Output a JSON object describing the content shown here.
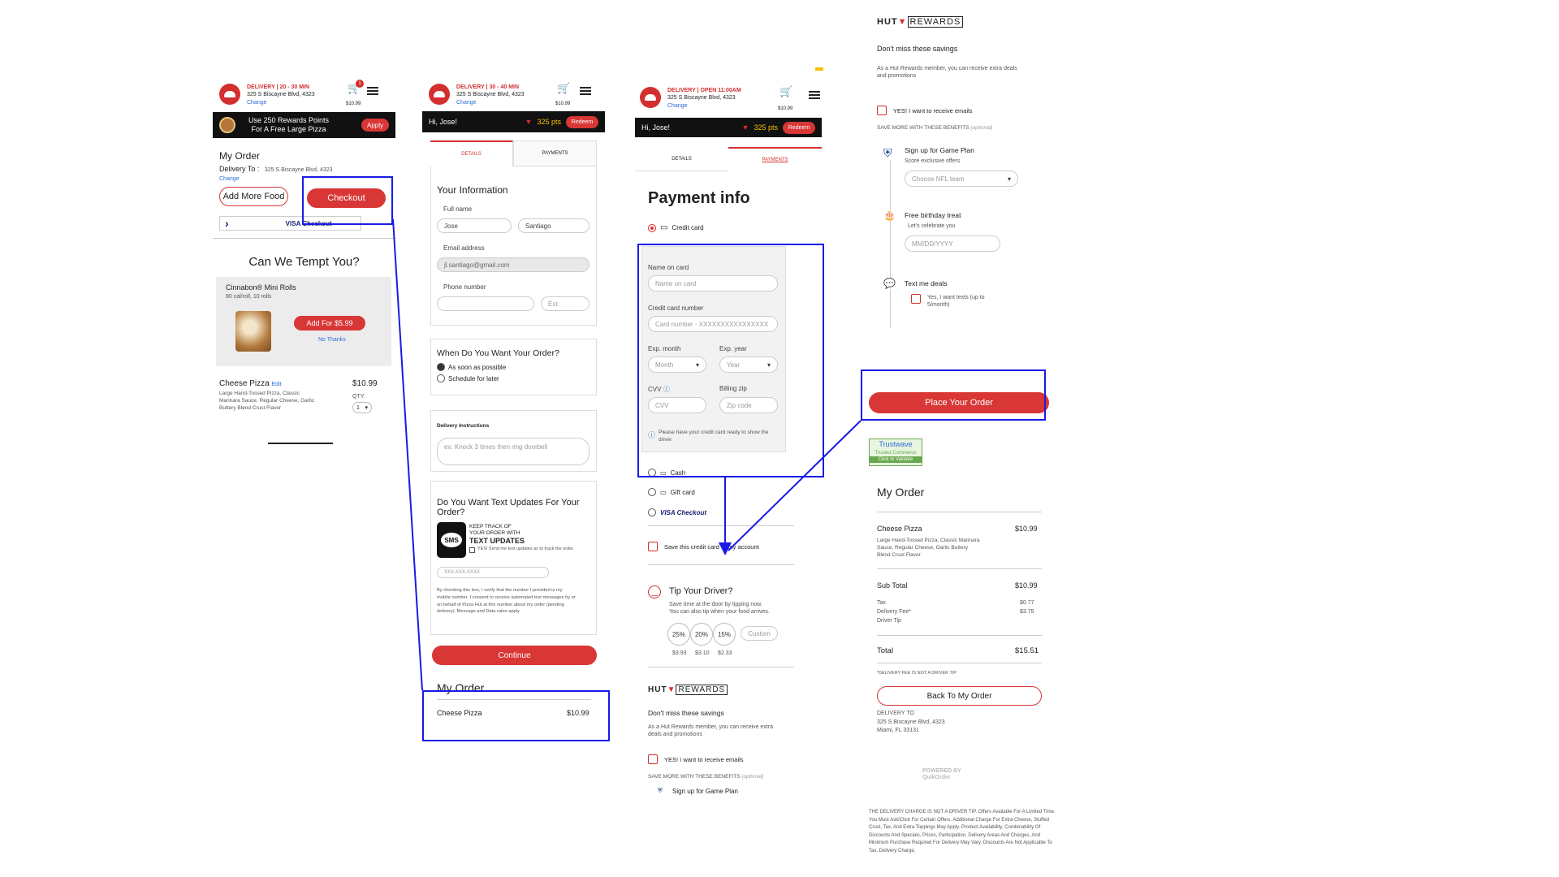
{
  "colors": {
    "brand": "#d93636",
    "highlight": "#1a1ae6",
    "dark": "#111111"
  },
  "s1": {
    "header": {
      "delivery": "DELIVERY | 20 - 30 MIN",
      "address": "325 S Biscayne Blvd, 4323",
      "change": "Change",
      "cart_total": "$10.99",
      "cart_count": "1"
    },
    "promo": {
      "text1": "Use 250 Rewards Points",
      "text2": "For A Free Large Pizza",
      "apply": "Apply"
    },
    "my_order": "My Order",
    "delivery_to_label": "Delivery To :",
    "delivery_to": "325 S Biscayne Blvd, 4323",
    "change": "Change",
    "add_more": "Add More Food",
    "checkout": "Checkout",
    "visa": "VISA Checkout",
    "tempt": "Can We Tempt You?",
    "upsell_name": "Cinnabon® Mini Rolls",
    "upsell_sub": "80 cal/roll, 10 rolls",
    "add_btn": "Add For $5.99",
    "no_thanks": "No Thanks",
    "item_name": "Cheese Pizza",
    "item_edit": "Edit",
    "item_price": "$10.99",
    "item_desc": "Large Hand-Tossed Pizza, Classic Marinara Sauce, Regular Cheese, Garlic Buttery Blend Crust Flavor",
    "qty_label": "QTY:",
    "qty": "1"
  },
  "s2": {
    "header": {
      "delivery": "DELIVERY | 30 - 40 MIN",
      "address": "325 S Biscayne Blvd, 4323",
      "change": "Change",
      "cart_total": "$10.99"
    },
    "bar": {
      "hi": "Hi, Jose!",
      "pts": "325 pts",
      "redeem": "Redeem"
    },
    "tabs": [
      "DETAILS",
      "PAYMENTS"
    ],
    "your_info": "Your Information",
    "full_name": "Full name",
    "first": "Jose",
    "last": "Santiago",
    "email_label": "Email address",
    "email": "jl.santiago@gmail.com",
    "phone_label": "Phone number",
    "ext": "Ext.",
    "when": "When Do You Want Your Order?",
    "asap": "As soon as possible",
    "schedule": "Schedule for later",
    "instructions_label": "Delivery Instructions",
    "instructions_ph": "ex: Knock 3 times then ring doorbell",
    "text_updates": "Do You Want Text Updates For Your Order?",
    "keep1": "KEEP TRACK OF",
    "keep2": "YOUR ORDER WITH",
    "keep3": "TEXT UPDATES",
    "sms": "SMS",
    "yes_send": "YES! Send me text updates as to track the order.",
    "phone_ph": "XXX-XXX-XXXX",
    "legal": "By checking this box, I verify that the number I provided is my mobile number. I consent to receive automated text messages by or on behalf of Pizza Hut at this number about my order (pending delivery). Message and Data rates apply.",
    "continue": "Continue",
    "my_order": "My Order",
    "item": "Cheese Pizza",
    "price": "$10.99"
  },
  "s3": {
    "header": {
      "delivery": "DELIVERY | OPEN 11:00AM",
      "address": "325 S Biscayne Blvd, 4323",
      "change": "Change",
      "cart_total": "$10.99"
    },
    "bar": {
      "hi": "Hi, Jose!",
      "pts": "325 pts",
      "redeem": "Redeem"
    },
    "tabs": [
      "DETAILS",
      "PAYMENTS"
    ],
    "title": "Payment info",
    "credit": "Credit card",
    "name_label": "Name on card",
    "name_ph": "Name on card",
    "num_label": "Credit card number",
    "num_ph": "Card number - XXXXXXXXXXXXXXXX",
    "month_label": "Exp. month",
    "month": "Month",
    "year_label": "Exp. year",
    "year": "Year",
    "cvv_label": "CVV",
    "cvv_ph": "CVV",
    "zip_label": "Billing zip",
    "zip_ph": "Zip code",
    "note": "Please have your credit card ready to show the driver.",
    "cash": "Cash",
    "gift": "Gift card",
    "visa": "VISA Checkout",
    "save_card": "Save this credit card to my account",
    "tip_title": "Tip Your Driver?",
    "tip_line1": "Save time at the door by tipping now.",
    "tip_line2": "You can also tip when your food arrives.",
    "tips": [
      "25%",
      "20%",
      "15%"
    ],
    "custom": "Custom",
    "tip_amts": [
      "$3.93",
      "$3.10",
      "$2.33"
    ],
    "hut": "HUT",
    "rewards": "REWARDS",
    "dont_miss": "Don't miss these savings",
    "member": "As a Hut Rewards member, you can receive extra deals and promotions",
    "yes_emails": "YES! I want to receive emails",
    "save_more": "SAVE MORE WITH THESE BENEFITS",
    "optional": "(optional)",
    "game_plan": "Sign up for Game Plan"
  },
  "s4": {
    "hut": "HUT",
    "rewards": "REWARDS",
    "dont_miss": "Don't miss these savings",
    "member": "As a Hut Rewards member, you can receive extra deals and promotions",
    "yes_emails": "YES! I want to receive emails",
    "save_more": "SAVE MORE WITH THESE BENEFITS",
    "optional": "(optional)",
    "game_plan": "Sign up for Game Plan",
    "game_sub": "Score exclusive offers",
    "nfl": "Choose NFL team",
    "birthday": "Free birthday treat",
    "bday_sub": "Let's celebrate you",
    "bday_ph": "MM/DD/YYYY",
    "text_deals": "Text me deals",
    "text_yes": "Yes, I want texts (up to 5/month)",
    "place": "Place Your Order",
    "trustwave": "Trustwave",
    "trust_sub": "Trusted Commerce",
    "trust_click": "Click to Validate",
    "my_order": "My Order",
    "item": "Cheese Pizza",
    "price": "$10.99",
    "desc": "Large Hand-Tossed Pizza, Classic Marinara Sauce, Regular Cheese, Garlic Buttery Blend Crust Flavor",
    "subtotal_label": "Sub Total",
    "subtotal": "$10.99",
    "tax_label": "Tax",
    "tax": "$0.77",
    "fee_label": "Delivery Fee*",
    "fee": "$3.75",
    "tip_label": "Driver Tip",
    "total_label": "Total",
    "total": "$15.51",
    "note": "*DELIVERY FEE IS NOT A DRIVER TIP",
    "back": "Back To My Order",
    "deliv_to": "DELIVERY TO",
    "addr1": "325 S Biscayne Blvd, 4323",
    "addr2": "Miami, FL 33131",
    "powered": "POWERED BY",
    "qo": "QuikOrder",
    "legal": "THE DELIVERY CHARGE IS NOT A DRIVER TIP. Offers Available For A Limited Time. You Must Ask/Click For Certain Offers. Additional Charge For Extra Cheese, Stuffed Crust, Tax, And Extra Toppings May Apply. Product Availability, Combinability Of Discounts And Specials, Prices, Participation, Delivery Areas And Charges, And Minimum Purchase Required For Delivery May Vary. Discounts Are Not Applicable To Tax, Delivery Charge,"
  }
}
